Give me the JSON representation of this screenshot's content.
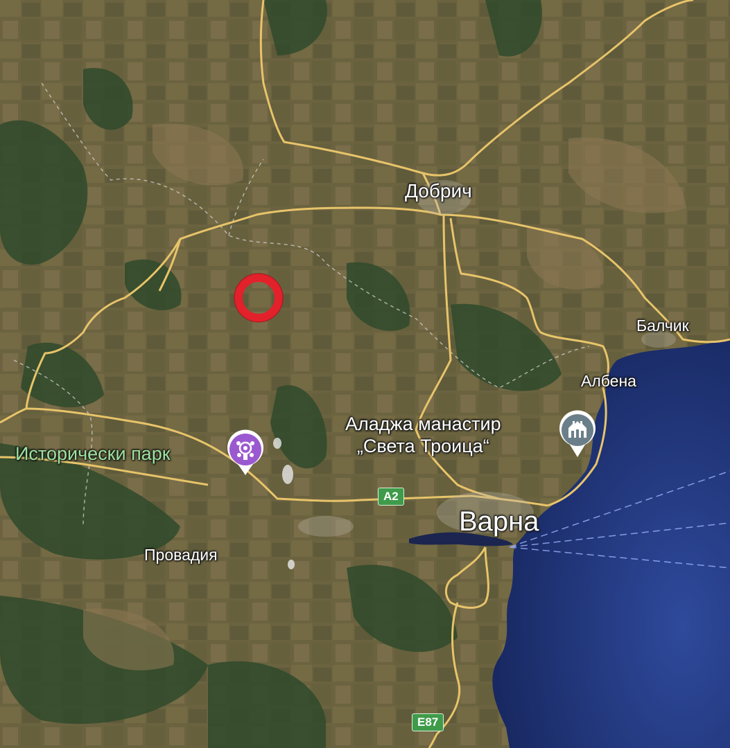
{
  "map": {
    "places": {
      "dobrich": "Добрич",
      "balchik": "Балчик",
      "albena": "Албена",
      "varna": "Варна",
      "provadia": "Провадия"
    },
    "pois": {
      "monastery_line1": "Аладжа манастир",
      "monastery_line2": "„Света Троица“",
      "historic_park": "Исторически парк"
    },
    "roads": {
      "a2": "A2",
      "e87": "E87"
    },
    "icons": {
      "target_marker": "red-ring-marker",
      "monastery_icon": "monastery-icon",
      "park_icon": "historic-park-icon"
    },
    "colors": {
      "sea": "#1f2f6e",
      "road": "#e8c46a",
      "marker": "#e3212b",
      "park_pin": "#9b59d0",
      "shield": "#3f9b4a"
    }
  }
}
